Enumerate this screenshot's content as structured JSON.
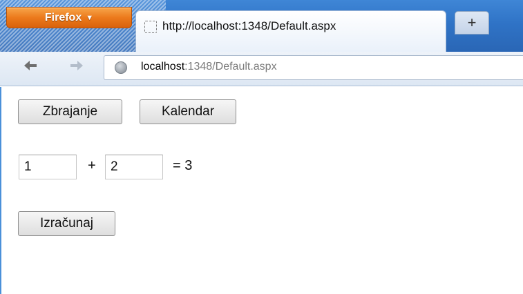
{
  "browser": {
    "menu_button": "Firefox",
    "tab": {
      "title": "http://localhost:1348/Default.aspx"
    },
    "new_tab_label": "+",
    "nav": {
      "back_icon": "back-arrow-icon",
      "forward_icon": "forward-arrow-icon"
    },
    "url": {
      "host": "localhost",
      "rest": ":1348/Default.aspx"
    }
  },
  "page": {
    "nav_buttons": [
      "Zbrajanje",
      "Kalendar"
    ],
    "operand_a": "1",
    "plus": "+",
    "operand_b": "2",
    "result": "= 3",
    "calculate_button": "Izračunaj"
  },
  "colors": {
    "firefox_button": "#e8781c",
    "titlebar": "#2f73c6",
    "page_border_accent": "#4a90d9"
  }
}
